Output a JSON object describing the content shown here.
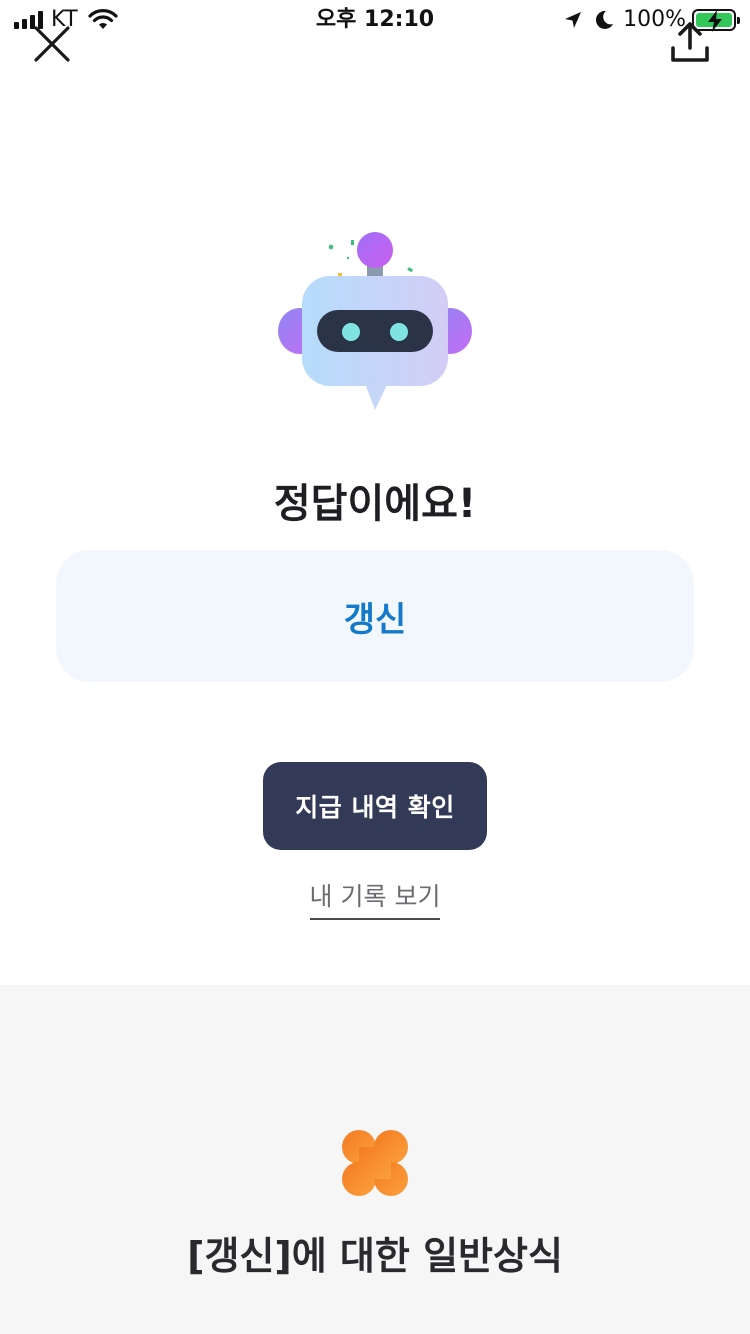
{
  "status_bar": {
    "carrier": "KT",
    "time": "오후 12:10",
    "battery": "100%"
  },
  "icons": {
    "close": "close-icon",
    "share": "share-icon",
    "robot": "robot-mascot-icon",
    "clover": "clover-icon"
  },
  "result": {
    "title": "정답이에요!",
    "answer": "갱신"
  },
  "actions": {
    "primary_label": "지급 내역 확인",
    "link_label": "내 기록 보기"
  },
  "knowledge": {
    "title": "[갱신]에 대한 일반상식"
  },
  "colors": {
    "primary_button": "#333a57",
    "answer_text": "#1479c8",
    "answer_bg": "#f1f7fd",
    "clover": "#f7892a",
    "battery_fill": "#34c759"
  }
}
